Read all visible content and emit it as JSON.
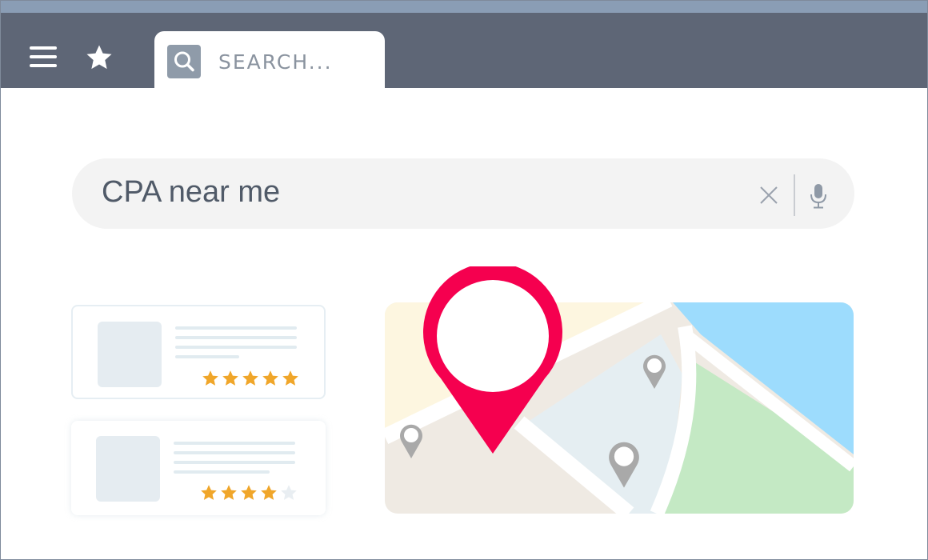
{
  "toolbar": {
    "menu_icon": "hamburger-menu-icon",
    "favorite_icon": "star-icon"
  },
  "tab": {
    "search_icon": "search-icon",
    "search_placeholder": "SEARCH..."
  },
  "query": {
    "text": "CPA near me",
    "clear_icon": "close-icon",
    "mic_icon": "microphone-icon"
  },
  "results": [
    {
      "rating": 5,
      "max_rating": 5
    },
    {
      "rating": 4,
      "max_rating": 5
    }
  ],
  "map": {
    "primary_pin_icon": "map-pin-icon",
    "secondary_pin_icon": "map-pin-icon",
    "secondary_pin_count": 3
  },
  "colors": {
    "toolbar": "#5e6676",
    "titlebar": "#8a9db5",
    "accent_pin": "#f5004f",
    "star": "#f0a62a",
    "star_empty": "#e9eef2",
    "map_yellow": "#fdf6e0",
    "map_beige": "#efeae3",
    "map_lightblue": "#e5eef2",
    "map_green": "#c4e9c4",
    "map_water": "#9ddcfd",
    "secondary_pin": "#a9a9a9"
  }
}
